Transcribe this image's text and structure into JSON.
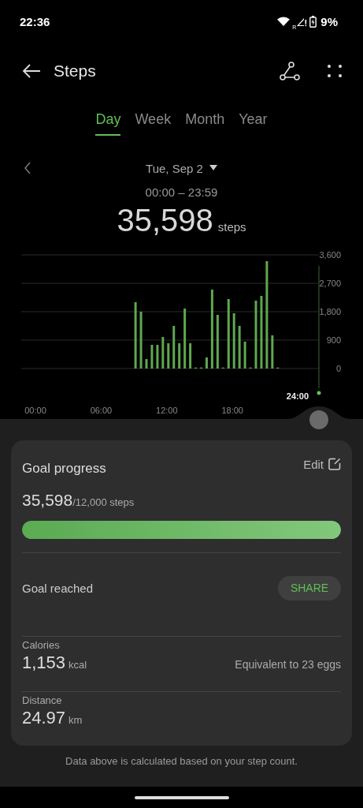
{
  "status_bar": {
    "time": "22:36",
    "roaming": "R",
    "battery": "9%"
  },
  "header": {
    "title": "Steps"
  },
  "tabs": [
    {
      "label": "Day",
      "selected": true
    },
    {
      "label": "Week",
      "selected": false
    },
    {
      "label": "Month",
      "selected": false
    },
    {
      "label": "Year",
      "selected": false
    }
  ],
  "date": {
    "label": "Tue, Sep 2",
    "range": "00:00 – 23:59",
    "total": "35,598",
    "unit": "steps"
  },
  "chart": {
    "cursor_label": "24:00",
    "chart_data": {
      "type": "bar",
      "x": [
        9,
        9.5,
        10,
        10.5,
        11,
        11.5,
        12,
        12.5,
        13,
        13.5,
        14,
        14.5,
        15,
        15.5,
        16,
        16.5,
        17,
        17.5,
        18,
        18.5,
        19,
        19.5,
        20,
        20.5,
        21,
        21.5,
        22
      ],
      "values": [
        2100,
        1800,
        300,
        750,
        750,
        1000,
        800,
        1350,
        800,
        1900,
        800,
        30,
        0,
        350,
        2500,
        1700,
        0,
        2200,
        1750,
        1350,
        850,
        30,
        2150,
        2300,
        3400,
        1050,
        30
      ],
      "xlim": [
        -1.3,
        25.9
      ],
      "ylim": [
        0,
        3600
      ],
      "grid": true,
      "xticks": [
        {
          "value": 0,
          "label": "00:00"
        },
        {
          "value": 6,
          "label": "06:00"
        },
        {
          "value": 12,
          "label": "12:00"
        },
        {
          "value": 18,
          "label": "18:00"
        }
      ],
      "yticks": [
        {
          "value": 0,
          "label": "0"
        },
        {
          "value": 900,
          "label": "900"
        },
        {
          "value": 1800,
          "label": "1,800"
        },
        {
          "value": 2700,
          "label": "2,700"
        },
        {
          "value": 3600,
          "label": "3,600"
        }
      ]
    }
  },
  "goal": {
    "title": "Goal progress",
    "edit": "Edit",
    "value": "35,598",
    "target": "/12,000 steps",
    "level": 1,
    "reached": "Goal reached",
    "share": "SHARE"
  },
  "stats": [
    {
      "label": "Calories",
      "value": "1,153",
      "unit": "kcal",
      "note": "Equivalent to 23 eggs"
    },
    {
      "label": "Distance",
      "value": "24.97",
      "unit": "km"
    }
  ],
  "footnote": "Data above is calculated based on your step count."
}
